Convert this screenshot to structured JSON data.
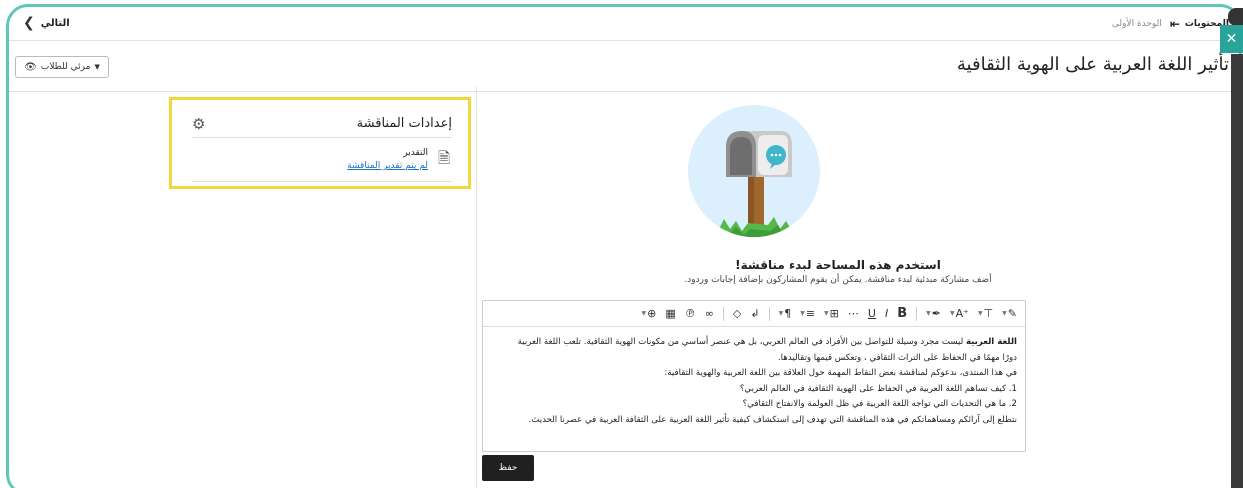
{
  "topbar": {
    "next_label": "التالي",
    "contents_label": "المحتويات",
    "unit_label": "الوحدة الأولى"
  },
  "page": {
    "title": "تأثير اللغة العربية على الهوية الثقافية",
    "visibility_label": "مرئي للطلاب"
  },
  "settings": {
    "title": "إعدادات المناقشة",
    "grade_label": "التقدير",
    "grade_link": "لم يتم تقدير المناقشة"
  },
  "empty_state": {
    "title": "استخدم هذه المساحة لبدء مناقشة!",
    "subtitle": "أضف مشاركة مبدئية لبدء مناقشة. يمكن أن يقوم المشاركون بإضافة إجابات وردود."
  },
  "editor": {
    "bold_lead": "اللغة العربية",
    "line1_rest": " ليست مجرد وسيلة للتواصل بين الأفراد في العالم العربي، بل هي عنصر أساسي من مكونات الهوية الثقافية. تلعب اللغة العربية",
    "line2": "دورًا مهمًا في الحفاظ على التراث الثقافي ، وتعكس قيمها وتقاليدها.",
    "line3": "في هذا المنتدى، ندعوكم لمناقشة بعض النقاط المهمة حول العلاقة بين اللغة العربية والهوية الثقافية:",
    "line4": "1. كيف تساهم اللغة العربية في الحفاظ على الهوية الثقافية في العالم العربي؟",
    "line5": "2. ما هي التحديات التي تواجه اللغة العربية في ظل العولمة والانفتاح الثقافي؟",
    "line6": "نتطلع إلى آرائكم ومساهماتكم في هذه المناقشة التي تهدف إلى استكشاف كيفية تأثير اللغة العربية على الثقافة العربية في عصرنا الحديث."
  },
  "actions": {
    "save_label": "حفظ"
  },
  "icons": {
    "close": "close-icon",
    "gear": "gear-icon",
    "eye": "eye-icon"
  },
  "colors": {
    "frame": "#5ec7b8",
    "highlight": "#f1d73a",
    "link": "#1a73c6",
    "save_bg": "#202020",
    "close_tab": "#2aa39a"
  }
}
